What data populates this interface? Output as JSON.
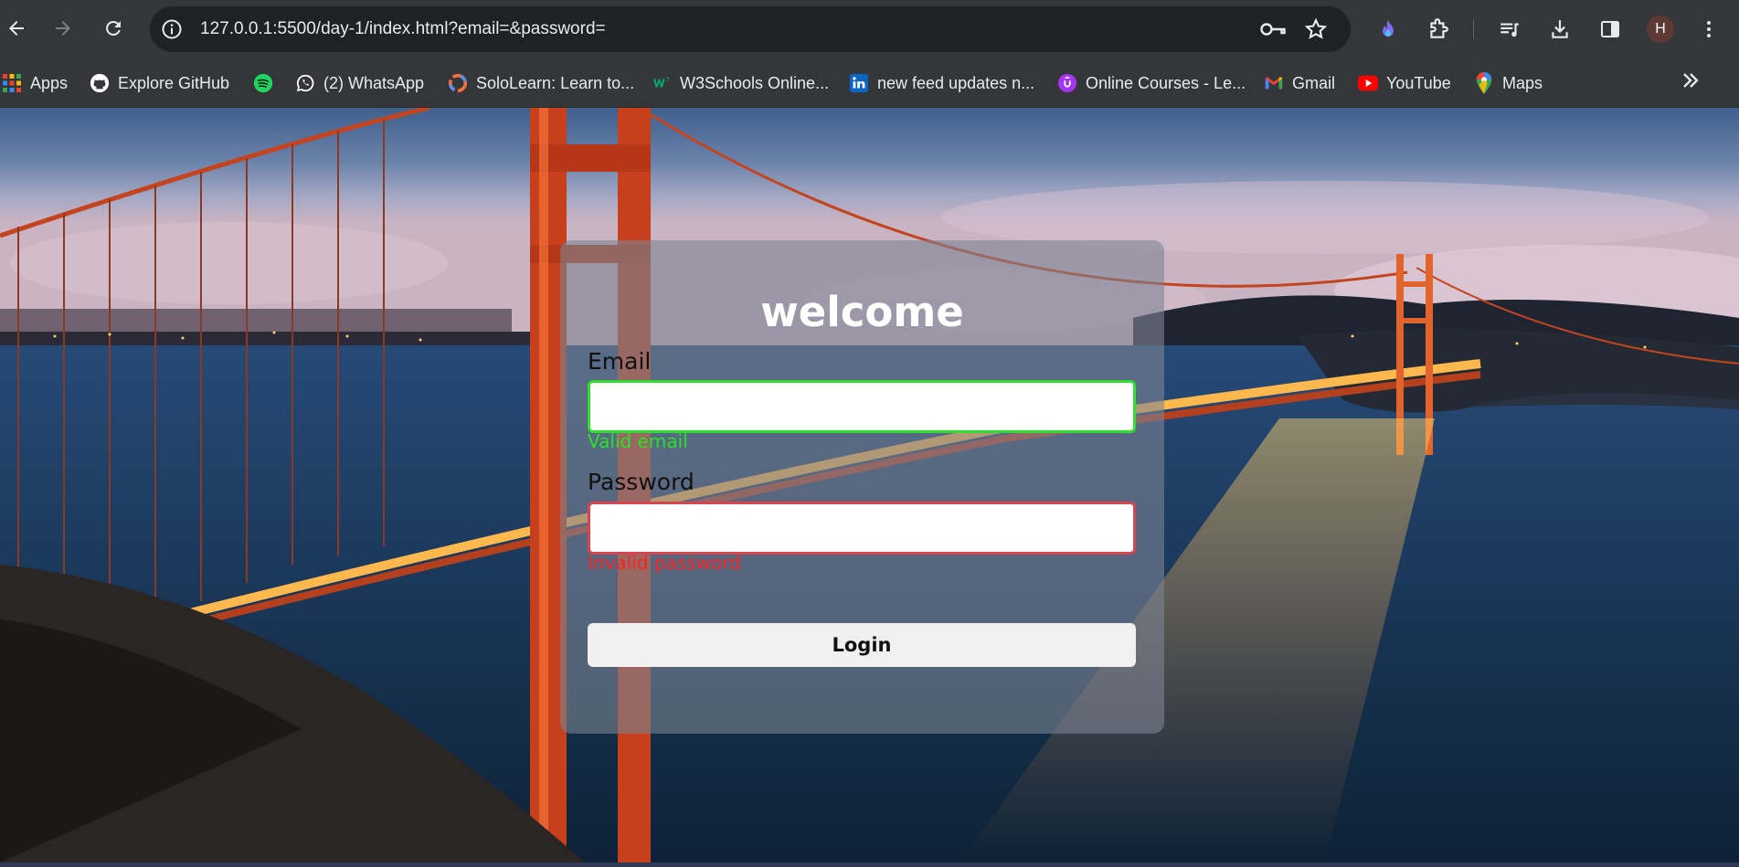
{
  "browser": {
    "url": "127.0.0.1:5500/day-1/index.html?email=&password=",
    "avatar_initial": "H",
    "bookmarks": [
      {
        "label": "Apps",
        "icon": "apps-grid-icon"
      },
      {
        "label": "Explore GitHub",
        "icon": "github-icon"
      },
      {
        "label": "",
        "icon": "spotify-icon"
      },
      {
        "label": "(2) WhatsApp",
        "icon": "whatsapp-icon"
      },
      {
        "label": "SoloLearn: Learn to...",
        "icon": "sololearn-icon"
      },
      {
        "label": "W3Schools Online...",
        "icon": "w3schools-icon"
      },
      {
        "label": "new feed updates n...",
        "icon": "linkedin-icon"
      },
      {
        "label": "Online Courses - Le...",
        "icon": "udemy-icon"
      },
      {
        "label": "Gmail",
        "icon": "gmail-icon"
      },
      {
        "label": "YouTube",
        "icon": "youtube-icon"
      },
      {
        "label": "Maps",
        "icon": "maps-icon"
      }
    ]
  },
  "login": {
    "title": "welcome",
    "email_label": "Email",
    "email_value": "",
    "email_message": "Valid email",
    "password_label": "Password",
    "password_value": "",
    "password_message": "Invalid password",
    "button_label": "Login"
  },
  "colors": {
    "chrome_bg": "#35363a",
    "omnibox_bg": "#202124",
    "valid": "#27e227",
    "invalid": "#ff2222"
  }
}
